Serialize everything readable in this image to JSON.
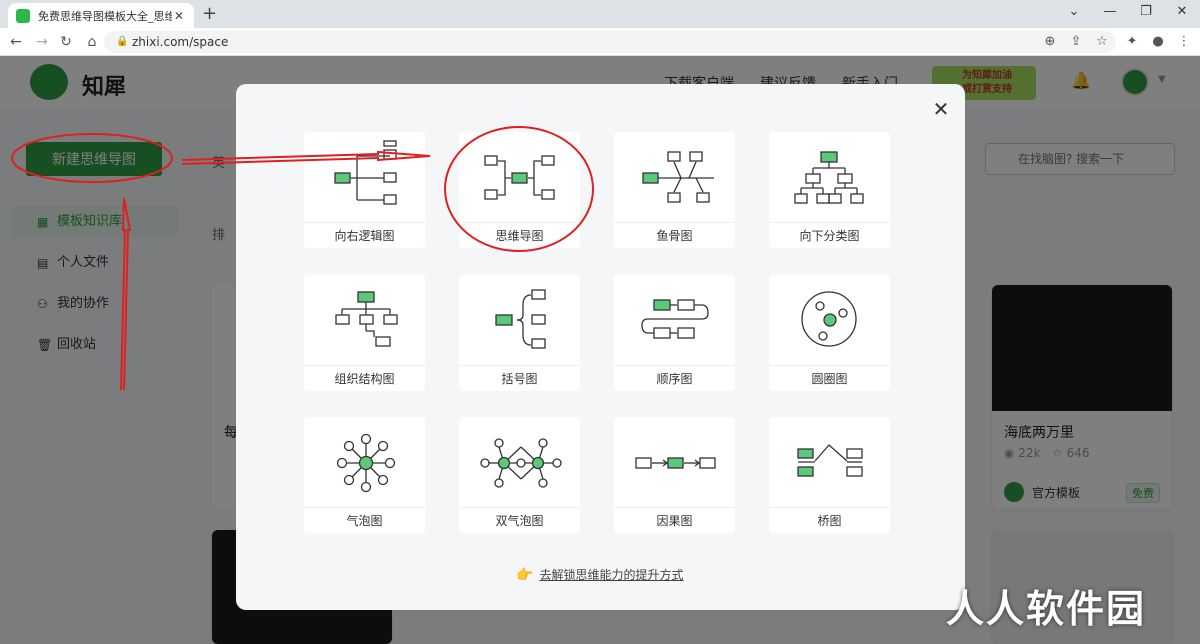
{
  "browser": {
    "tab_title": "免费思维导图模板大全_思维导图",
    "tab_close": "✕",
    "new_tab": "+",
    "url": "zhixi.com/space",
    "window_min": "—",
    "window_restore": "❐",
    "window_close": "✕",
    "caret": "⌄"
  },
  "header": {
    "logo_text": "知犀",
    "nav": [
      "下载客户端",
      "建议反馈",
      "新手入门"
    ],
    "promo_line1": "为知犀加油",
    "promo_line2": "或打赏支持"
  },
  "sidebar": {
    "new_button": "新建思维导图",
    "items": [
      {
        "label": "模板知识库",
        "icon": "grid-icon"
      },
      {
        "label": "个人文件",
        "icon": "document-icon"
      },
      {
        "label": "我的协作",
        "icon": "users-icon"
      },
      {
        "label": "回收站",
        "icon": "trash-icon"
      }
    ]
  },
  "main": {
    "partial_label_1": "英",
    "partial_label_2": "排",
    "partial_title": "每",
    "search_placeholder": "在找脑图? 搜索一下",
    "card": {
      "title": "海底两万里",
      "views": "22k",
      "stars": "646",
      "owner": "官方模板",
      "badge": "免费"
    }
  },
  "modal": {
    "close": "✕",
    "templates": [
      {
        "label": "向右逻辑图"
      },
      {
        "label": "思维导图"
      },
      {
        "label": "鱼骨图"
      },
      {
        "label": "向下分类图"
      },
      {
        "label": "组织结构图"
      },
      {
        "label": "括号图"
      },
      {
        "label": "顺序图"
      },
      {
        "label": "圆圈图"
      },
      {
        "label": "气泡图"
      },
      {
        "label": "双气泡图"
      },
      {
        "label": "因果图"
      },
      {
        "label": "桥图"
      }
    ],
    "tip_icon": "👉",
    "tip_link": "去解锁思维能力的提升方式"
  },
  "watermark": "人人软件园",
  "colors": {
    "brand_green": "#2f9e44",
    "node_green": "#5bc87a",
    "annotation_red": "#e02020"
  }
}
